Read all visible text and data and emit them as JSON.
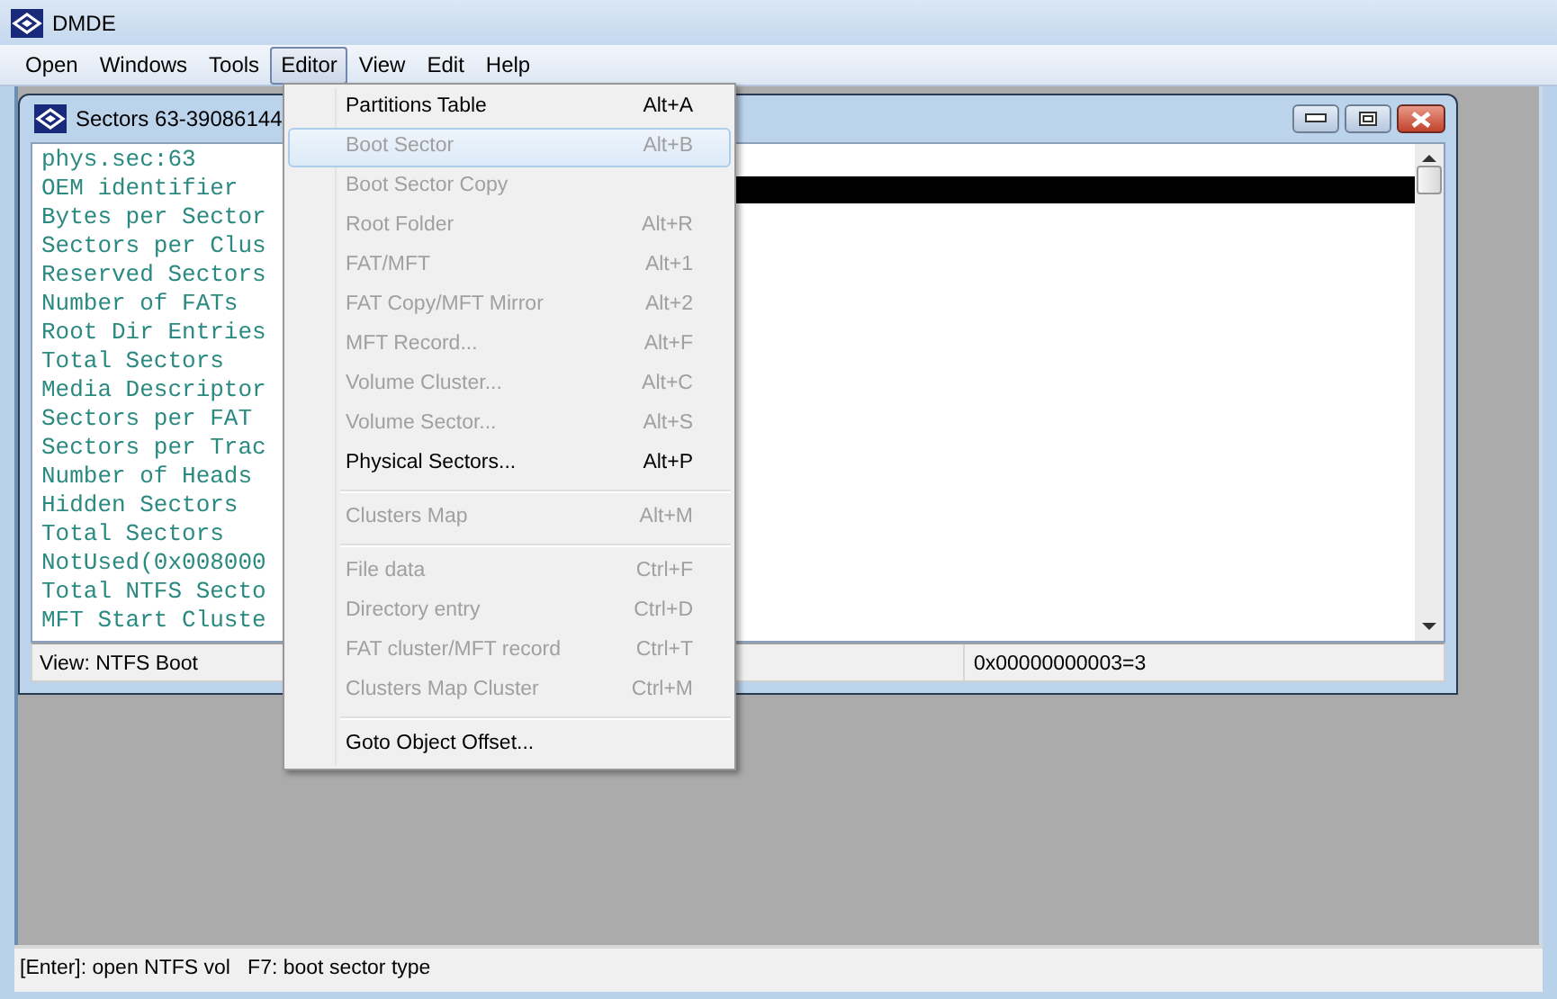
{
  "window": {
    "title": "DMDE"
  },
  "menu_bar": [
    {
      "label": "Open",
      "selected": false
    },
    {
      "label": "Windows",
      "selected": false
    },
    {
      "label": "Tools",
      "selected": false
    },
    {
      "label": "Editor",
      "selected": true
    },
    {
      "label": "View",
      "selected": false
    },
    {
      "label": "Edit",
      "selected": false
    },
    {
      "label": "Help",
      "selected": false
    }
  ],
  "child_window": {
    "title": "Sectors 63-39086144",
    "lines": [
      {
        "text": "phys.sec:63",
        "selected": false
      },
      {
        "text": "OEM identifier",
        "selected": true
      },
      {
        "text": "Bytes per Sector",
        "selected": false
      },
      {
        "text": "Sectors per Clus",
        "selected": false
      },
      {
        "text": "Reserved Sectors",
        "selected": false
      },
      {
        "text": "Number of FATs",
        "selected": false
      },
      {
        "text": "Root Dir Entries",
        "selected": false
      },
      {
        "text": "Total Sectors",
        "selected": false
      },
      {
        "text": "Media Descriptor",
        "selected": false
      },
      {
        "text": "Sectors per FAT",
        "selected": false
      },
      {
        "text": "Sectors per Trac",
        "selected": false
      },
      {
        "text": "Number of Heads",
        "selected": false
      },
      {
        "text": "Hidden Sectors",
        "selected": false
      },
      {
        "text": "Total Sectors",
        "selected": false
      },
      {
        "text": "NotUsed(0x008000",
        "selected": false
      },
      {
        "text": "Total NTFS Secto",
        "selected": false
      },
      {
        "text": "MFT Start Cluste",
        "selected": false
      }
    ],
    "status_left": "View: NTFS Boot",
    "status_right": "0x00000000003=3"
  },
  "editor_menu": [
    {
      "kind": "item",
      "label": "Partitions Table",
      "shortcut": "Alt+A",
      "disabled": false,
      "selected": false
    },
    {
      "kind": "item",
      "label": "Boot Sector",
      "shortcut": "Alt+B",
      "disabled": true,
      "selected": true
    },
    {
      "kind": "item",
      "label": "Boot Sector Copy",
      "disabled": true,
      "selected": false
    },
    {
      "kind": "item",
      "label": "Root Folder",
      "shortcut": "Alt+R",
      "disabled": true,
      "selected": false
    },
    {
      "kind": "item",
      "label": "FAT/MFT",
      "shortcut": "Alt+1",
      "disabled": true,
      "selected": false
    },
    {
      "kind": "item",
      "label": "FAT Copy/MFT Mirror",
      "shortcut": "Alt+2",
      "disabled": true,
      "selected": false
    },
    {
      "kind": "item",
      "label": "MFT Record...",
      "shortcut": "Alt+F",
      "disabled": true,
      "selected": false
    },
    {
      "kind": "item",
      "label": "Volume Cluster...",
      "shortcut": "Alt+C",
      "disabled": true,
      "selected": false
    },
    {
      "kind": "item",
      "label": "Volume Sector...",
      "shortcut": "Alt+S",
      "disabled": true,
      "selected": false
    },
    {
      "kind": "item",
      "label": "Physical Sectors...",
      "shortcut": "Alt+P",
      "disabled": false,
      "selected": false
    },
    {
      "kind": "separator"
    },
    {
      "kind": "item",
      "label": "Clusters Map",
      "shortcut": "Alt+M",
      "disabled": true,
      "selected": false
    },
    {
      "kind": "separator"
    },
    {
      "kind": "item",
      "label": "File data",
      "shortcut": "Ctrl+F",
      "disabled": true,
      "selected": false
    },
    {
      "kind": "item",
      "label": "Directory entry",
      "shortcut": "Ctrl+D",
      "disabled": true,
      "selected": false
    },
    {
      "kind": "item",
      "label": "FAT cluster/MFT record",
      "shortcut": "Ctrl+T",
      "disabled": true,
      "selected": false
    },
    {
      "kind": "item",
      "label": "Clusters Map Cluster",
      "shortcut": "Ctrl+M",
      "disabled": true,
      "selected": false
    },
    {
      "kind": "separator"
    },
    {
      "kind": "item",
      "label": "Goto Object Offset...",
      "disabled": false,
      "selected": false
    }
  ],
  "status_bar": "[Enter]: open NTFS vol   F7: boot sector type"
}
